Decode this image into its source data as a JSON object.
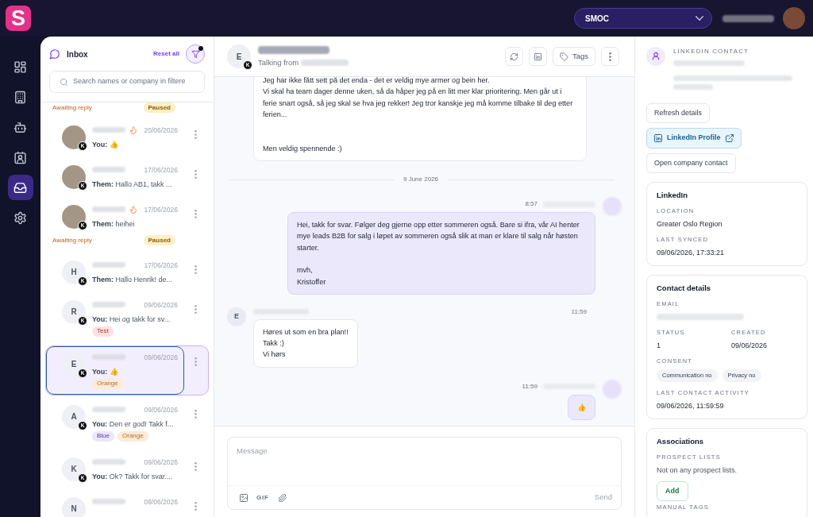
{
  "app": {
    "logo": "S",
    "workspace": "SMOC"
  },
  "nav": [
    {
      "selected": false
    },
    {
      "selected": false
    },
    {
      "selected": false
    },
    {
      "selected": false
    },
    {
      "selected": true
    },
    {
      "selected": false
    }
  ],
  "inbox": {
    "title": "Inbox",
    "reset": "Reset all",
    "filter_active": true,
    "search": {
      "placeholder": "Search names or company in filtere"
    },
    "partial_row": {
      "status": "Awaiting reply",
      "badge": "Paused"
    },
    "conversations": [
      {
        "avatar": {
          "kind": "photo"
        },
        "channel": "K",
        "hot": true,
        "date": "20/06/2026",
        "preview": "**You:** 👍",
        "selected": false
      },
      {
        "avatar": {
          "kind": "photo"
        },
        "channel": "K",
        "hot": false,
        "date": "17/06/2026",
        "preview": "**Them:** Hallo AB1, takk ...",
        "selected": false
      },
      {
        "avatar": {
          "kind": "photo"
        },
        "channel": "K",
        "hot": true,
        "date": "17/06/2026",
        "preview": "**Them:** heihei",
        "status": "Awaiting reply",
        "badge": "Paused",
        "selected": false
      },
      {
        "avatar": {
          "kind": "initial",
          "letter": "H"
        },
        "channel": "K",
        "hot": false,
        "date": "17/06/2026",
        "preview": "**Them:** Hallo Henrik! de...",
        "selected": false
      },
      {
        "avatar": {
          "kind": "initial",
          "letter": "R"
        },
        "channel": "K",
        "hot": false,
        "date": "09/06/2026",
        "preview": "**You:** Hei og takk for sv...",
        "tags": [
          {
            "label": "Test",
            "color": "#fde1e0"
          }
        ],
        "selected": false
      },
      {
        "avatar": {
          "kind": "initial",
          "letter": "E"
        },
        "channel": "K",
        "hot": false,
        "date": "09/06/2026",
        "preview": "**You:** 👍",
        "tags": [
          {
            "label": "Orange",
            "color": "#fdead7"
          }
        ],
        "selected": true
      },
      {
        "avatar": {
          "kind": "initial",
          "letter": "A"
        },
        "channel": "K",
        "hot": false,
        "date": "09/06/2026",
        "preview": "**You:** Den er god! Takk f...",
        "tags": [
          {
            "label": "Blue",
            "color": "#ece6fb"
          },
          {
            "label": "Orange",
            "color": "#fdead7"
          }
        ],
        "selected": false
      },
      {
        "avatar": {
          "kind": "initial",
          "letter": "K"
        },
        "channel": "K",
        "hot": false,
        "date": "09/06/2026",
        "preview": "**You:** Ok? Takk for svar....",
        "selected": false
      },
      {
        "avatar": {
          "kind": "initial",
          "letter": "N"
        },
        "hot": false,
        "date": "09/06/2026",
        "selected": false
      }
    ]
  },
  "chat": {
    "contact": {
      "avatar": {
        "kind": "initial",
        "letter": "E"
      },
      "channel": "K",
      "subtitle": "Talking from"
    },
    "tags_button": "Tags",
    "messages": [
      {
        "kind": "incoming",
        "text": "Jeg har ikke fått sett på det enda - det er veldig mye armer og bein her.\nVi skal ha team dager denne uken, så da håper jeg på en litt mer klar prioritering. Men går ut i ferie snart også, så jeg skal se hva jeg rekker! Jeg tror kanskje jeg må komme tilbake til deg etter ferien...\n\n\nMen veldig spennende :)"
      },
      {
        "kind": "date",
        "text": "9 June 2026"
      },
      {
        "kind": "outgoing",
        "time": "8:57",
        "text": "Hei, takk for svar. Følger deg gjerne opp etter sommeren også. Bare si ifra, vår AI henter mye leads B2B for salg i løpet av sommeren også slik at man er klare til salg når høsten starter.\n\nmvh,\nKristoffer"
      },
      {
        "kind": "incoming",
        "avatar": {
          "kind": "initial",
          "letter": "E"
        },
        "time": "11:59",
        "text": "Høres ut som en bra plan!!\nTakk :)\nVi hørs"
      },
      {
        "kind": "outgoing",
        "time": "11:59",
        "text": "👍"
      }
    ],
    "composer": {
      "placeholder": "Message",
      "gif": "GIF",
      "send": "Send",
      "send_enabled": false
    }
  },
  "contact_panel": {
    "label": "LINKEDIN CONTACT",
    "actions": [
      {
        "kind": "plain",
        "label": "Refresh details"
      },
      {
        "kind": "linkedin",
        "label": "LinkedIn Profile"
      },
      {
        "kind": "plain",
        "label": "Open company contact"
      }
    ],
    "cards": [
      {
        "title": "LinkedIn",
        "fields": [
          {
            "kind": "text",
            "label": "LOCATION",
            "value": "Greater Oslo Region"
          },
          {
            "kind": "text",
            "label": "LAST SYNCED",
            "value": "09/06/2026, 17:33:21"
          }
        ]
      },
      {
        "title": "Contact details",
        "fields": [
          {
            "kind": "redacted",
            "label": "EMAIL"
          },
          {
            "kind": "pair",
            "items": [
              {
                "label": "STATUS",
                "value": "1"
              },
              {
                "label": "CREATED",
                "value": "09/06/2026"
              }
            ]
          },
          {
            "kind": "chips",
            "label": "CONSENT",
            "chips": [
              "Communication no",
              "Privacy no"
            ]
          },
          {
            "kind": "text",
            "label": "LAST CONTACT ACTIVITY",
            "value": "09/06/2026, 11:59:59"
          }
        ]
      },
      {
        "title": "Associations",
        "fields": [
          {
            "kind": "note",
            "label": "PROSPECT LISTS",
            "value": "Not on any prospect lists."
          },
          {
            "kind": "button",
            "label": "Add"
          },
          {
            "kind": "heading",
            "label": "MANUAL TAGS"
          }
        ]
      }
    ]
  }
}
